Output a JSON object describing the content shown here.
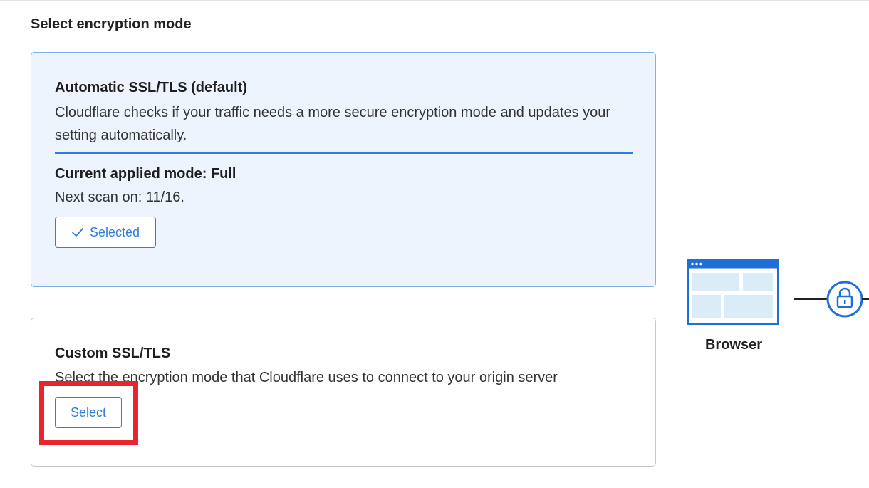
{
  "section": {
    "title": "Select encryption mode"
  },
  "automatic": {
    "title": "Automatic SSL/TLS (default)",
    "description": "Cloudflare checks if your traffic needs a more secure encryption mode and updates your setting automatically.",
    "current_mode_label": "Current applied mode: Full",
    "next_scan": "Next scan on: 11/16.",
    "button_label": "Selected",
    "button_icon": "check-icon"
  },
  "custom": {
    "title": "Custom SSL/TLS",
    "description": "Select the encryption mode that Cloudflare uses to connect to your origin server",
    "button_label": "Select"
  },
  "diagram": {
    "browser_label": "Browser",
    "browser_icon": "browser-window-icon",
    "lock_icon": "lock-icon"
  },
  "colors": {
    "accent": "#2f7de1",
    "selected_card_bg": "#eef4fd",
    "highlight": "#e8242c"
  }
}
